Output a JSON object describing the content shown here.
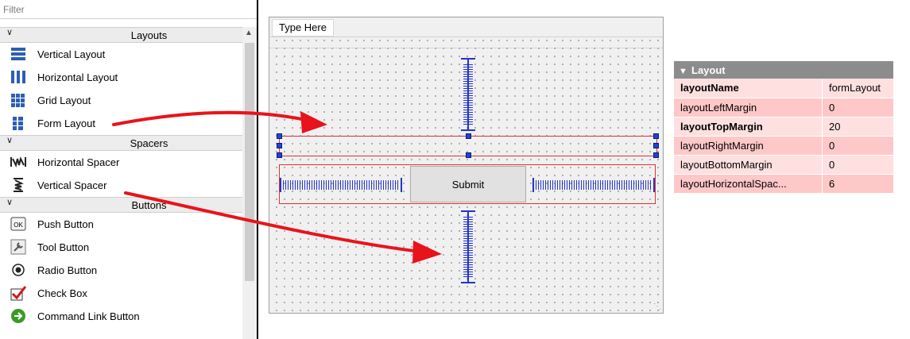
{
  "widget_box": {
    "filter_placeholder": "Filter",
    "categories": [
      {
        "label": "Layouts",
        "items": [
          {
            "label": "Vertical Layout",
            "icon": "vertical-layout-icon"
          },
          {
            "label": "Horizontal Layout",
            "icon": "horizontal-layout-icon"
          },
          {
            "label": "Grid Layout",
            "icon": "grid-layout-icon"
          },
          {
            "label": "Form Layout",
            "icon": "form-layout-icon"
          }
        ]
      },
      {
        "label": "Spacers",
        "items": [
          {
            "label": "Horizontal Spacer",
            "icon": "horizontal-spacer-icon"
          },
          {
            "label": "Vertical Spacer",
            "icon": "vertical-spacer-icon"
          }
        ]
      },
      {
        "label": "Buttons",
        "items": [
          {
            "label": "Push Button",
            "icon": "push-button-icon"
          },
          {
            "label": "Tool Button",
            "icon": "tool-button-icon"
          },
          {
            "label": "Radio Button",
            "icon": "radio-button-icon"
          },
          {
            "label": "Check Box",
            "icon": "check-box-icon"
          },
          {
            "label": "Command Link Button",
            "icon": "command-link-icon"
          }
        ]
      }
    ]
  },
  "form": {
    "menu_type_here": "Type Here",
    "submit_label": "Submit"
  },
  "property_editor": {
    "section_title": "Layout",
    "rows": [
      {
        "name": "layoutName",
        "value": "formLayout",
        "bold": true,
        "bg": "#ffe0e0"
      },
      {
        "name": "layoutLeftMargin",
        "value": "0",
        "bold": false,
        "bg": "#ffc8c8"
      },
      {
        "name": "layoutTopMargin",
        "value": "20",
        "bold": true,
        "bg": "#ffe0e0"
      },
      {
        "name": "layoutRightMargin",
        "value": "0",
        "bold": false,
        "bg": "#ffc8c8"
      },
      {
        "name": "layoutBottomMargin",
        "value": "0",
        "bold": false,
        "bg": "#ffe0e0"
      },
      {
        "name": "layoutHorizontalSpac...",
        "value": "6",
        "bold": false,
        "bg": "#ffc8c8"
      }
    ]
  },
  "colors": {
    "arrow": "#e8141b",
    "spacer_blue": "#2233cc",
    "layout_outline": "#e03030",
    "prop_header_bg": "#8c8c8c"
  }
}
